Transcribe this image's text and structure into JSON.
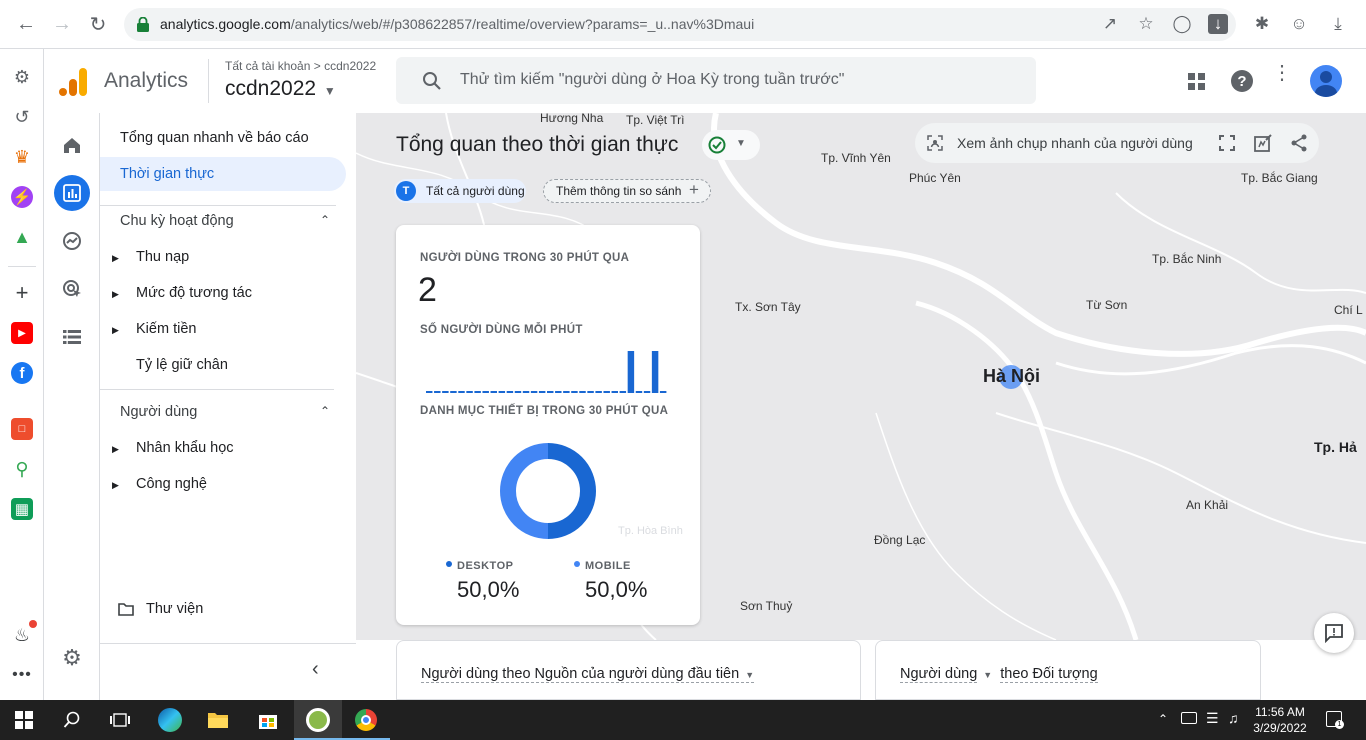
{
  "browser": {
    "url_domain": "analytics.google.com",
    "url_path": "/analytics/web/#/p308622857/realtime/overview?params=_u..nav%3Dmaui"
  },
  "app": {
    "name": "Analytics",
    "breadcrumb_parent": "Tất cả tài khoản",
    "breadcrumb_sep": ">",
    "breadcrumb_account": "ccdn2022",
    "property": "ccdn2022",
    "search_placeholder": "Thử tìm kiếm \"người dùng ở Hoa Kỳ trong tuần trước\""
  },
  "nav": {
    "reports_snapshot": "Tổng quan nhanh về báo cáo",
    "realtime": "Thời gian thực",
    "lifecycle_section": "Chu kỳ hoạt động",
    "lifecycle_items": [
      "Thu nạp",
      "Mức độ tương tác",
      "Kiếm tiền",
      "Tỷ lệ giữ chân"
    ],
    "user_section": "Người dùng",
    "user_items": [
      "Nhân khẩu học",
      "Công nghệ"
    ],
    "library": "Thư viện"
  },
  "page": {
    "title": "Tổng quan theo thời gian thực",
    "chip_avatar": "T",
    "chip_all_users": "Tất cả người dùng",
    "chip_add_comparison": "Thêm thông tin so sánh",
    "snapshot_button": "Xem ảnh chụp nhanh của người dùng"
  },
  "card": {
    "users_30min_label": "NGƯỜI DÙNG TRONG 30 PHÚT QUA",
    "users_30min_value": "2",
    "users_per_minute_label": "SỐ NGƯỜI DÙNG MỖI PHÚT",
    "per_minute_values": [
      0,
      0,
      0,
      0,
      0,
      0,
      0,
      0,
      0,
      0,
      0,
      0,
      0,
      0,
      0,
      0,
      0,
      0,
      0,
      0,
      0,
      0,
      0,
      0,
      0,
      1,
      0,
      0,
      1,
      0
    ],
    "device_label": "DANH MỤC THIẾT BỊ TRONG 30 PHÚT QUA",
    "devices": [
      {
        "name": "DESKTOP",
        "value": "50,0%",
        "share": 0.5,
        "color": "#1967d2"
      },
      {
        "name": "MOBILE",
        "value": "50,0%",
        "share": 0.5,
        "color": "#4285f4"
      }
    ]
  },
  "map": {
    "places": [
      {
        "name": "Hương Nha"
      },
      {
        "name": "Tp. Việt Trì"
      },
      {
        "name": "Tp. Vĩnh Yên"
      },
      {
        "name": "Phúc Yên"
      },
      {
        "name": "Tp. Bắc Giang"
      },
      {
        "name": "Tp. Bắc Ninh"
      },
      {
        "name": "Tx. Sơn Tây"
      },
      {
        "name": "Từ Sơn"
      },
      {
        "name": "Chí L"
      },
      {
        "name": "Hà Nội"
      },
      {
        "name": "Tp. Hả"
      },
      {
        "name": "An Khải"
      },
      {
        "name": "Đồng Lạc"
      },
      {
        "name": "Sơn Thuỷ"
      },
      {
        "name": "Tp. Hòa Bình"
      }
    ]
  },
  "bottom": {
    "card1_title": "Người dùng theo Nguồn của người dùng đầu tiên",
    "card2_metric": "Người dùng",
    "card2_rest": "theo Đối tượng"
  },
  "taskbar": {
    "time": "11:56 AM",
    "date": "3/29/2022"
  },
  "colors": {
    "accent": "#1a73e8",
    "selected_bg": "#e8f0fe",
    "logo_orange": "#f9ab00",
    "logo_dark": "#e37400"
  }
}
